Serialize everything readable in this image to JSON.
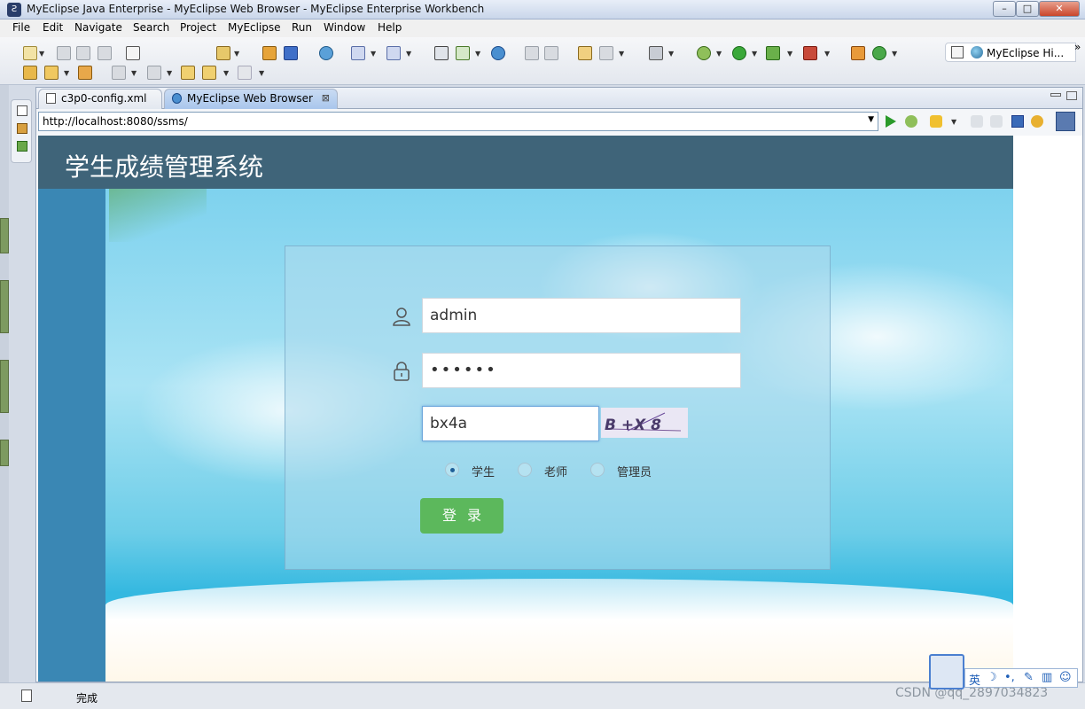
{
  "window": {
    "title": "MyEclipse Java Enterprise - MyEclipse Web Browser - MyEclipse Enterprise Workbench",
    "minimize_label": "–",
    "maximize_label": "□",
    "close_label": "✕"
  },
  "menubar": {
    "items": [
      "File",
      "Edit",
      "Navigate",
      "Search",
      "Project",
      "MyEclipse",
      "Run",
      "Window",
      "Help"
    ]
  },
  "toolbar": {
    "perspective_label": "MyEclipse Hi...",
    "overflow_label": "»"
  },
  "editor": {
    "tabs": [
      {
        "label": "c3p0-config.xml",
        "active": false
      },
      {
        "label": "MyEclipse Web Browser",
        "active": true,
        "close": "⊠"
      }
    ]
  },
  "browser": {
    "url": "http://localhost:8080/ssms/"
  },
  "page": {
    "site_title": "学生成绩管理系统",
    "login": {
      "username_value": "admin",
      "password_value": "••••••",
      "captcha_value": "bx4a",
      "captcha_image_text": "B +X 8",
      "roles": [
        {
          "label": "学生",
          "selected": true
        },
        {
          "label": "老师",
          "selected": false
        },
        {
          "label": "管理员",
          "selected": false
        }
      ],
      "submit_label": "登录"
    }
  },
  "statusbar": {
    "text": "完成",
    "watermark": "CSDN @qq_2897034823"
  },
  "ime": {
    "items": [
      "英",
      "☽",
      "•,",
      "✎",
      "▥",
      "☺"
    ]
  },
  "colors": {
    "site_header": "#3f6479",
    "login_button": "#5cb85c",
    "page_bg": "#3a87b4"
  }
}
